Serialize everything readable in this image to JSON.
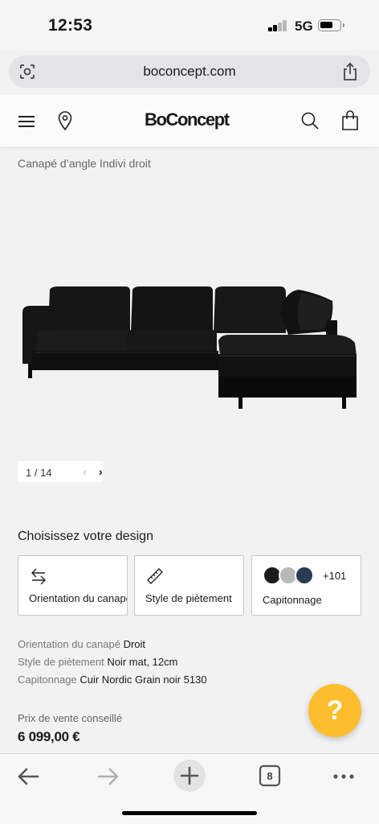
{
  "status_bar": {
    "time": "12:53",
    "network": "5G"
  },
  "browser": {
    "url": "boconcept.com"
  },
  "header": {
    "logo": "BoConcept"
  },
  "product": {
    "name": "Canapé d’angle Indivi droit"
  },
  "gallery": {
    "counter": "1 / 14",
    "prev": "‹",
    "next": "›"
  },
  "design": {
    "heading": "Choisissez votre design",
    "options": [
      {
        "label": "Orientation du canapé"
      },
      {
        "label": "Style de piètement"
      },
      {
        "label": "Capitonnage",
        "more": "+101"
      }
    ]
  },
  "summary": [
    {
      "key": "Orientation du canapé",
      "value": "Droit"
    },
    {
      "key": "Style de piètement",
      "value": "Noir mat, 12cm"
    },
    {
      "key": "Capitonnage",
      "value": "Cuir Nordic Grain noir 5130"
    }
  ],
  "price": {
    "label": "Prix de vente conseillé",
    "value": "6 099,00 €"
  },
  "help": {
    "label": "?"
  },
  "toolbar": {
    "tab_count": "8"
  },
  "colors": {
    "help_button": "#fdbd2d",
    "swatches": [
      "#1c1c1c",
      "#b9b9b9",
      "#2a3b55"
    ]
  }
}
